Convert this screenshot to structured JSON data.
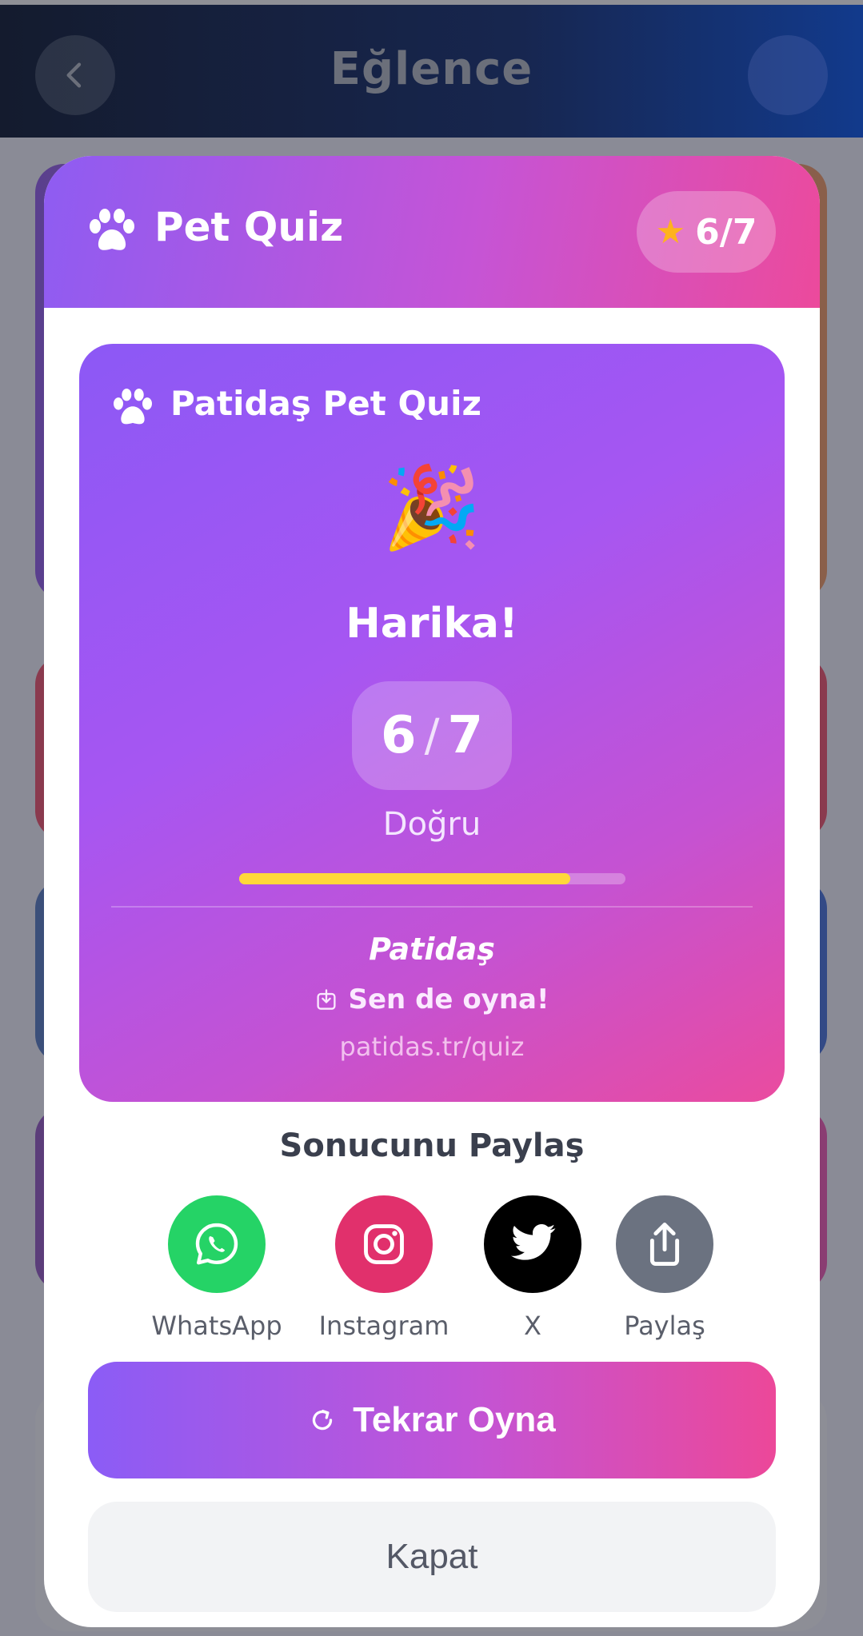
{
  "header": {
    "title": "Eğlence"
  },
  "modal": {
    "title": "Pet Quiz",
    "score_badge": "6/7",
    "card": {
      "title": "Patidaş Pet Quiz",
      "emoji": "🎉",
      "headline": "Harika!",
      "score": {
        "correct": "6",
        "total": "7"
      },
      "score_label": "Doğru",
      "progress_fraction": 0.857,
      "brand": "Patidaş",
      "cta": "Sen de oyna!",
      "url": "patidas.tr/quiz"
    },
    "share": {
      "title": "Sonucunu Paylaş",
      "items": [
        {
          "label": "WhatsApp",
          "icon": "whatsapp-icon",
          "color": "#25d366"
        },
        {
          "label": "Instagram",
          "icon": "instagram-icon",
          "color": "#e1306c"
        },
        {
          "label": "X",
          "icon": "twitter-bird-icon",
          "color": "#000000"
        },
        {
          "label": "Paylaş",
          "icon": "share-icon",
          "color": "#6b7280"
        }
      ]
    },
    "replay_label": "Tekrar Oyna",
    "close_label": "Kapat"
  },
  "colors": {
    "gradient_start": "#8b5cf6",
    "gradient_end": "#ec4899",
    "progress_fill": "#ffd83a",
    "star": "#ffb21e"
  }
}
